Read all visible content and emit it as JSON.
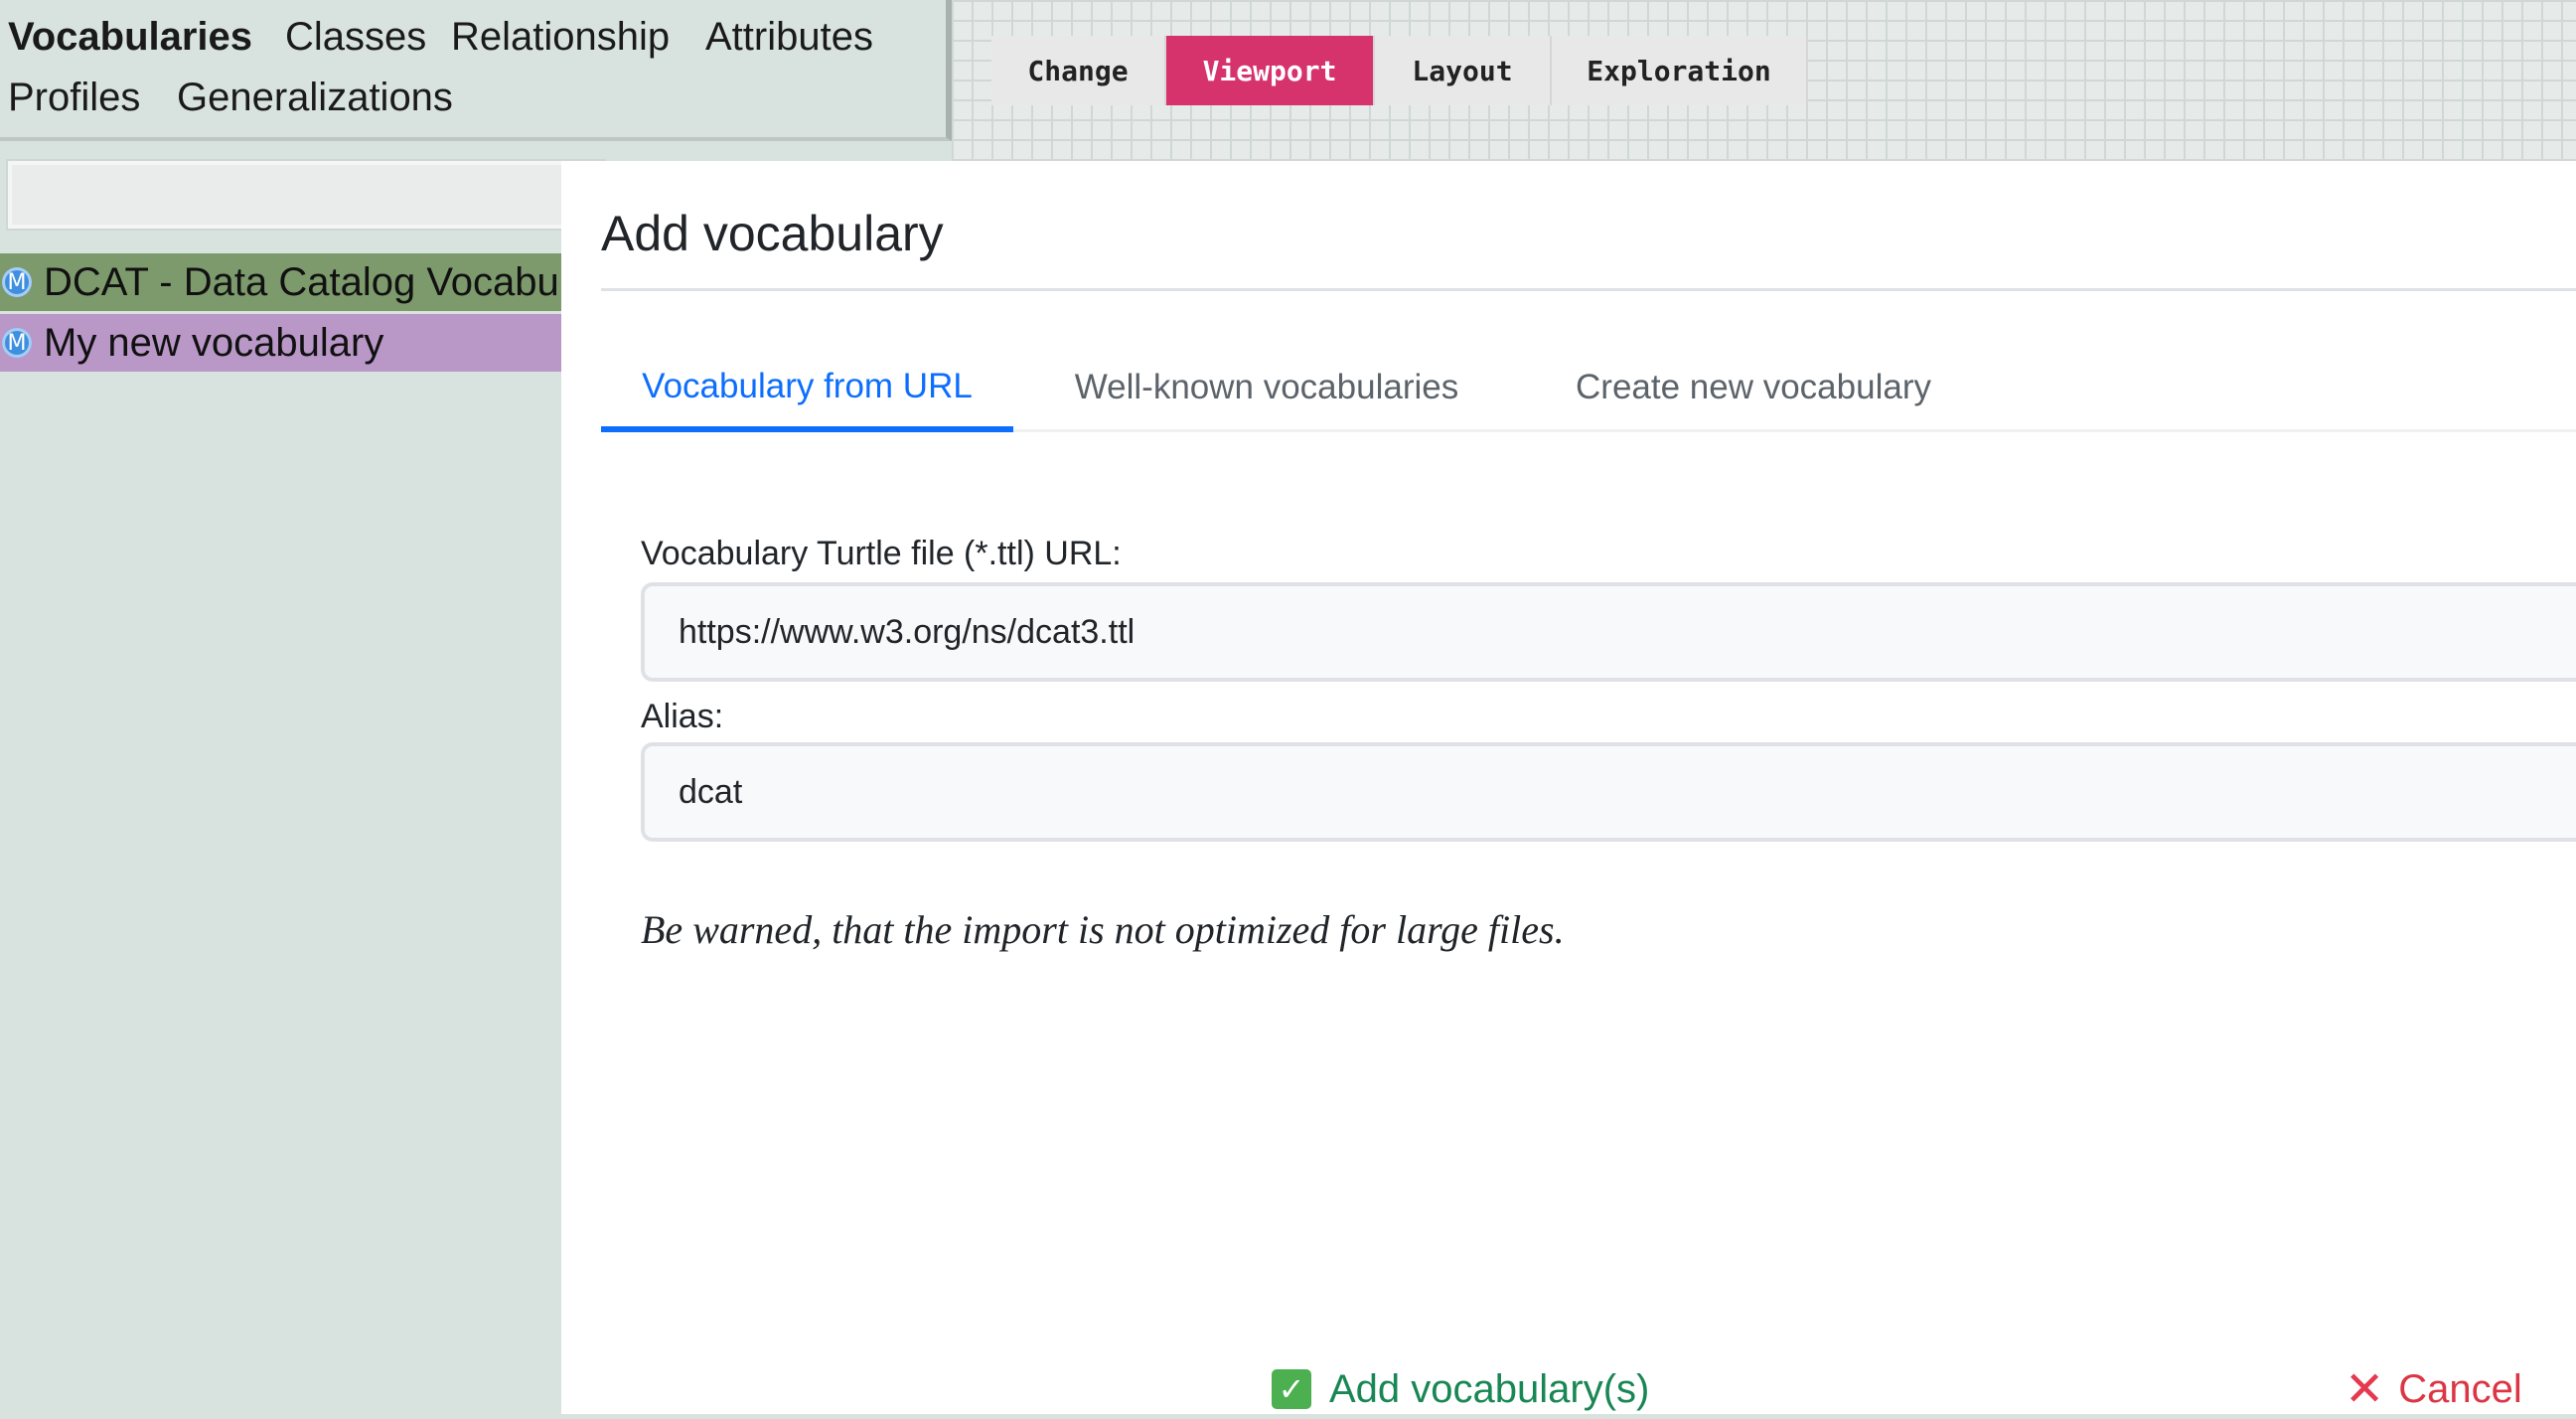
{
  "left_panel": {
    "tabs": [
      {
        "label": "Vocabularies",
        "active": true
      },
      {
        "label": "Classes"
      },
      {
        "label": "Relationship"
      },
      {
        "label": "Attributes"
      },
      {
        "label": "Profiles"
      },
      {
        "label": "Generalizations"
      }
    ],
    "search_value": "",
    "vocabularies": [
      {
        "badge": "M",
        "label": "DCAT - Data Catalog Vocabulary",
        "color": "#7d9a6c"
      },
      {
        "badge": "M",
        "label": "My new vocabulary",
        "color": "#b998c8"
      }
    ]
  },
  "toolbar": {
    "buttons": [
      {
        "label": "Change"
      },
      {
        "label": "Viewport",
        "active": true,
        "color": "#d6336c"
      },
      {
        "label": "Layout"
      },
      {
        "label": "Exploration"
      }
    ]
  },
  "modal": {
    "title": "Add vocabulary",
    "tabs": [
      {
        "label": "Vocabulary from URL",
        "active": true
      },
      {
        "label": "Well-known vocabularies"
      },
      {
        "label": "Create new vocabulary"
      }
    ],
    "url_field": {
      "label": "Vocabulary Turtle file (*.ttl) URL:",
      "value": "https://www.w3.org/ns/dcat3.ttl"
    },
    "alias_field": {
      "label": "Alias:",
      "value": "dcat"
    },
    "warning": "Be warned, that the import is not optimized for large files.",
    "add_button": {
      "label": "Add vocabulary(s)",
      "icon": "check-icon",
      "color": "#198754"
    },
    "cancel_button": {
      "label": "Cancel",
      "icon": "close-icon",
      "color": "#dc3545"
    }
  }
}
